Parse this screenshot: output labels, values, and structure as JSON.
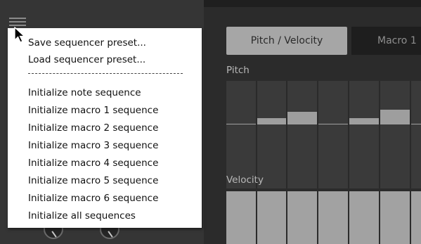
{
  "menu": {
    "items": [
      "Save sequencer preset...",
      "Load sequencer preset...",
      "Initialize note sequence",
      "Initialize macro 1 sequence",
      "Initialize macro 2 sequence",
      "Initialize macro 3 sequence",
      "Initialize macro 4 sequence",
      "Initialize macro 5 sequence",
      "Initialize macro 6 sequence",
      "Initialize all sequences"
    ]
  },
  "tabs": [
    {
      "label": "Pitch / Velocity",
      "active": true
    },
    {
      "label": "Macro 1",
      "active": false
    }
  ],
  "sections": {
    "pitch_label": "Pitch",
    "velocity_label": "Velocity"
  },
  "icons": {
    "menu": "hamburger-menu-icon",
    "cursor": "mouse-pointer-icon"
  },
  "colors": {
    "menu_bg": "#ffffff",
    "active_tab": "#a6a6a6",
    "step_fill": "#9e9e9e",
    "panel_bg": "#2b2b2b"
  }
}
